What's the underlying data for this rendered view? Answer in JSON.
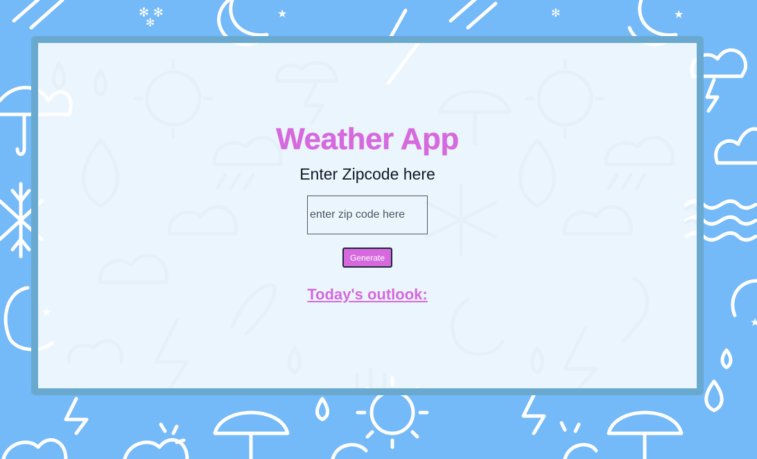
{
  "app": {
    "title": "Weather App",
    "subtitle": "Enter Zipcode here"
  },
  "form": {
    "zip_value": "",
    "zip_placeholder": "enter zip code here",
    "generate_label": "Generate"
  },
  "outlook": {
    "heading": "Today's outlook:"
  },
  "colors": {
    "background": "#74b9f8",
    "accent": "#d569dd",
    "frame_border": "#6aa9cf",
    "panel": "#eef5fc"
  },
  "icons": {
    "background_pattern": [
      "sun-icon",
      "cloud-icon",
      "moon-icon",
      "star-icon",
      "lightning-icon",
      "raindrop-icon",
      "umbrella-icon",
      "snowflake-icon",
      "wind-icon",
      "waves-icon"
    ]
  }
}
